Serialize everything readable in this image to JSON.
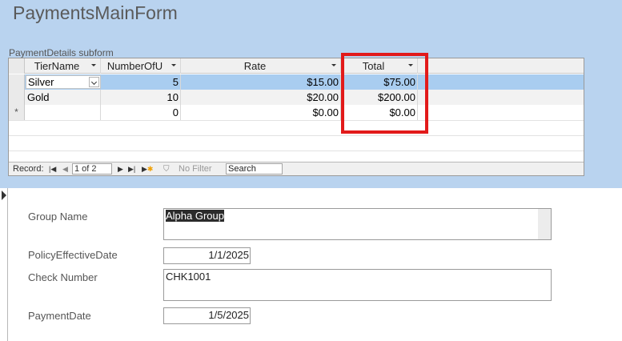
{
  "form": {
    "title": "PaymentsMainForm"
  },
  "subform": {
    "label": "PaymentDetails subform",
    "columns": [
      "TierName",
      "NumberOfU",
      "Rate",
      "Total"
    ],
    "rows": [
      {
        "selector": "",
        "tier": "Silver",
        "number": "5",
        "rate": "$15.00",
        "total": "$75.00"
      },
      {
        "selector": "",
        "tier": "Gold",
        "number": "10",
        "rate": "$20.00",
        "total": "$200.00"
      },
      {
        "selector": "*",
        "tier": "",
        "number": "0",
        "rate": "$0.00",
        "total": "$0.00"
      }
    ],
    "navigation": {
      "record_label": "Record:",
      "record_value": "1 of 2",
      "no_filter": "No Filter",
      "search": "Search"
    }
  },
  "fields": {
    "group_name": {
      "label": "Group Name",
      "value": "Alpha Group"
    },
    "policy_effective_date": {
      "label": "PolicyEffectiveDate",
      "value": "1/1/2025"
    },
    "check_number": {
      "label": "Check Number",
      "value": "CHK1001"
    },
    "payment_date": {
      "label": "PaymentDate",
      "value": "1/5/2025"
    }
  },
  "colors": {
    "header_bg": "#b9d3ef",
    "selected_row": "#a9cdf0",
    "highlight": "#e21a1a"
  }
}
